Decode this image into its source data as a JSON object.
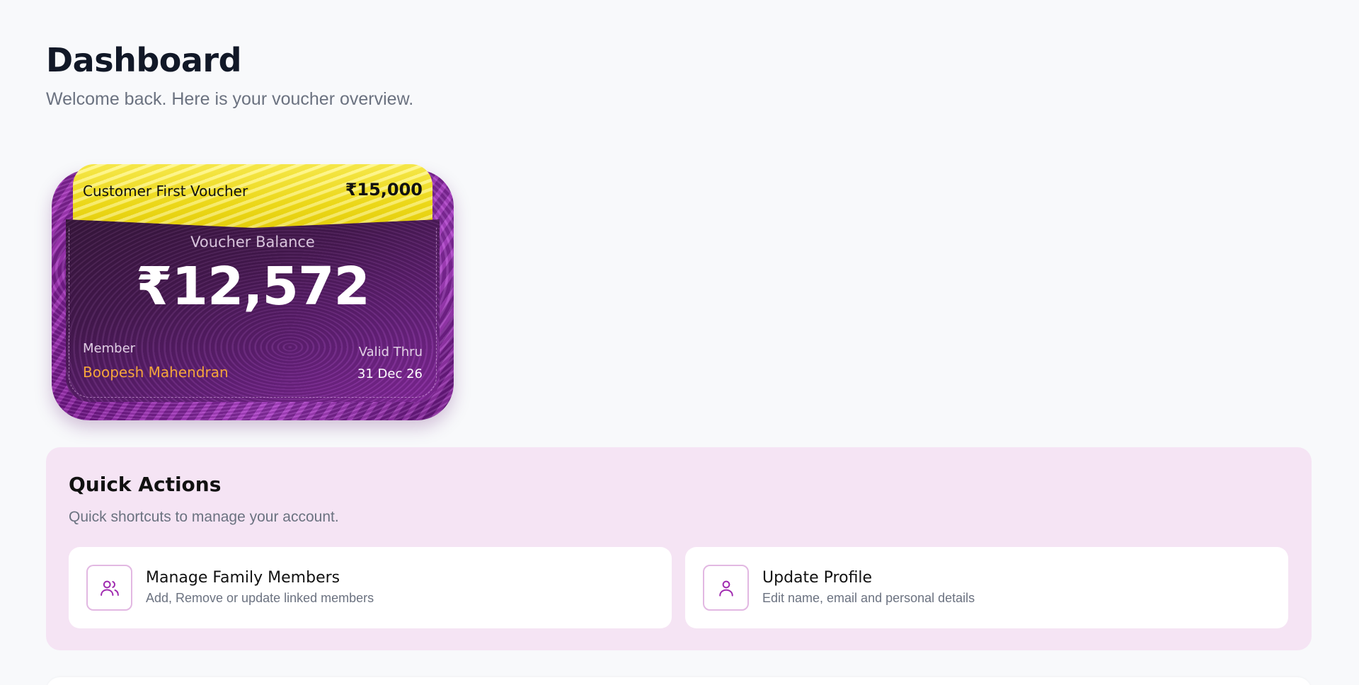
{
  "header": {
    "title": "Dashboard",
    "subtitle": "Welcome back. Here is your voucher overview."
  },
  "voucher": {
    "name": "Customer First Voucher",
    "amount": "₹15,000",
    "balance_label": "Voucher Balance",
    "balance_value": "₹12,572",
    "member_label": "Member",
    "member_name": "Boopesh Mahendran",
    "valid_label": "Valid Thru",
    "valid_date": "31 Dec 26"
  },
  "quick_actions": {
    "title": "Quick Actions",
    "subtitle": "Quick shortcuts to manage your account.",
    "items": [
      {
        "icon": "users-icon",
        "title": "Manage Family Members",
        "description": "Add, Remove or update linked members"
      },
      {
        "icon": "user-icon",
        "title": "Update Profile",
        "description": "Edit name, email and personal details"
      }
    ]
  },
  "colors": {
    "page_background": "#f8f9fb",
    "accent_purple": "#a02bb0",
    "member_name": "#f5a53a",
    "quick_actions_background": "#f5e4f4"
  }
}
